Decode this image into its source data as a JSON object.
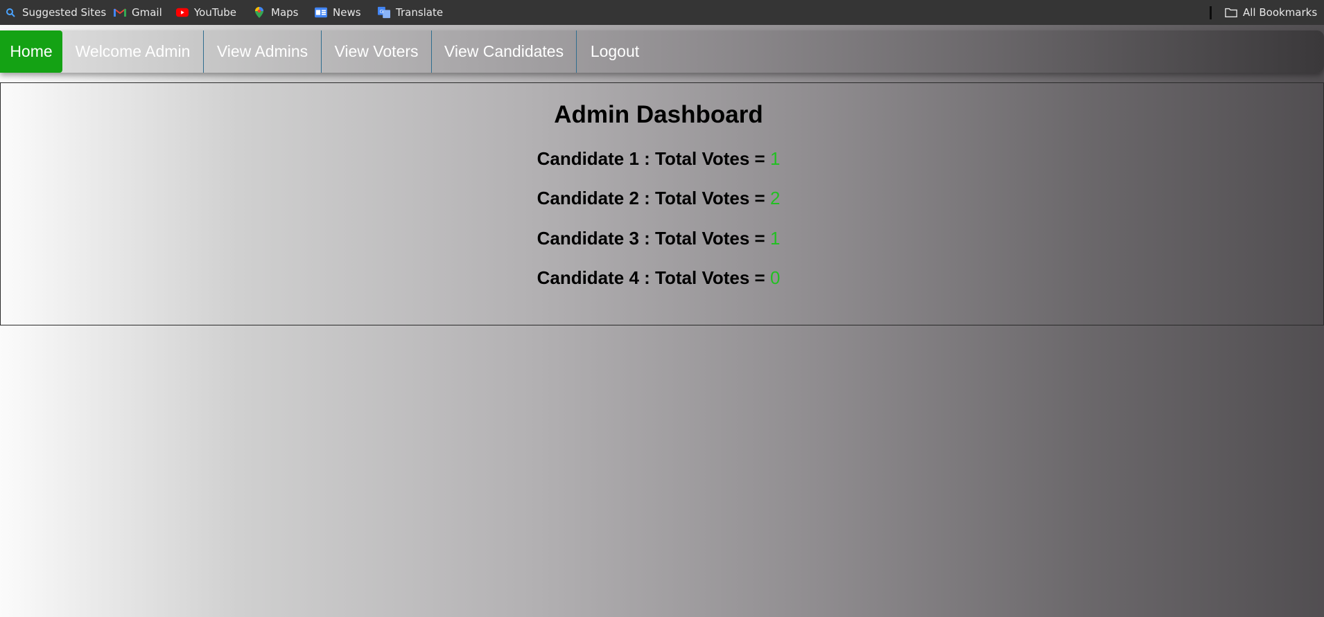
{
  "bookmarks": [
    {
      "label": "Suggested Sites",
      "icon": "search-icon"
    },
    {
      "label": "Gmail",
      "icon": "gmail-icon"
    },
    {
      "label": "YouTube",
      "icon": "youtube-icon"
    },
    {
      "label": "Maps",
      "icon": "maps-pin-icon"
    },
    {
      "label": "News",
      "icon": "google-news-icon"
    },
    {
      "label": "Translate",
      "icon": "google-translate-icon"
    }
  ],
  "all_bookmarks": {
    "label": "All Bookmarks",
    "icon": "folder-icon"
  },
  "nav": {
    "items": [
      {
        "label": "Home"
      },
      {
        "label": "Welcome Admin"
      },
      {
        "label": "View Admins"
      },
      {
        "label": "View Voters"
      },
      {
        "label": "View Candidates"
      },
      {
        "label": "Logout"
      }
    ]
  },
  "dashboard": {
    "title": "Admin Dashboard",
    "candidates": [
      {
        "label": "Candidate 1 : Total Votes = ",
        "votes": "1"
      },
      {
        "label": "Candidate 2 : Total Votes = ",
        "votes": "2"
      },
      {
        "label": "Candidate 3 : Total Votes = ",
        "votes": "1"
      },
      {
        "label": "Candidate 4 : Total Votes = ",
        "votes": "0"
      }
    ]
  },
  "colors": {
    "home_active": "#14a214",
    "vote_count": "#22c022",
    "bookmarks_bar": "#353535"
  }
}
